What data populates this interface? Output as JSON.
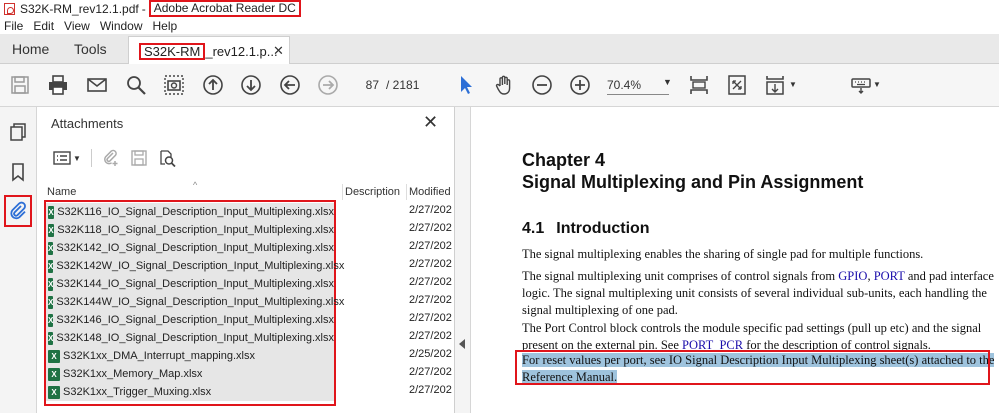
{
  "window": {
    "doc_filename": "S32K-RM_rev12.1.pdf",
    "separator": "-",
    "app_name": "Adobe Acrobat Reader DC"
  },
  "menu": [
    "File",
    "Edit",
    "View",
    "Window",
    "Help"
  ],
  "tabs": {
    "home": "Home",
    "tools": "Tools",
    "doc_tab_highlight": "S32K-RM",
    "doc_tab_rest": "_rev12.1.p...",
    "close_glyph": "✕"
  },
  "toolbar": {
    "page_current": "87",
    "page_total": "/  2181",
    "zoom": "70.4%",
    "icons": [
      "save-icon",
      "print-icon",
      "email-icon",
      "search-icon",
      "screenshot-icon",
      "page-up-icon",
      "page-down-icon",
      "back-icon",
      "forward-icon",
      "select-cursor-icon",
      "hand-icon",
      "zoom-out-icon",
      "zoom-in-icon",
      "fit-page-icon",
      "full-screen-icon",
      "scroll-mode-icon",
      "keyboard-icon"
    ]
  },
  "attachments": {
    "title": "Attachments",
    "close_glyph": "✕",
    "columns": {
      "name": "Name",
      "description": "Description",
      "modified": "Modified"
    },
    "files": [
      {
        "name": "S32K116_IO_Signal_Description_Input_Multiplexing.xlsx",
        "modified": "2/27/202"
      },
      {
        "name": "S32K118_IO_Signal_Description_Input_Multiplexing.xlsx",
        "modified": "2/27/202"
      },
      {
        "name": "S32K142_IO_Signal_Description_Input_Multiplexing.xlsx",
        "modified": "2/27/202"
      },
      {
        "name": "S32K142W_IO_Signal_Description_Input_Multiplexing.xlsx",
        "modified": "2/27/202"
      },
      {
        "name": "S32K144_IO_Signal_Description_Input_Multiplexing.xlsx",
        "modified": "2/27/202"
      },
      {
        "name": "S32K144W_IO_Signal_Description_Input_Multiplexing.xlsx",
        "modified": "2/27/202"
      },
      {
        "name": "S32K146_IO_Signal_Description_Input_Multiplexing.xlsx",
        "modified": "2/27/202"
      },
      {
        "name": "S32K148_IO_Signal_Description_Input_Multiplexing.xlsx",
        "modified": "2/27/202"
      },
      {
        "name": "S32K1xx_DMA_Interrupt_mapping.xlsx",
        "modified": "2/25/202"
      },
      {
        "name": "S32K1xx_Memory_Map.xlsx",
        "modified": "2/27/202"
      },
      {
        "name": "S32K1xx_Trigger_Muxing.xlsx",
        "modified": "2/27/202"
      }
    ]
  },
  "document": {
    "chapter": "Chapter 4",
    "chapter_title": "Signal Multiplexing and Pin Assignment",
    "section_num": "4.1",
    "section_title": "Introduction",
    "p1": "The signal multiplexing enables the sharing of single pad for multiple functions.",
    "p2_a": "The signal multiplexing unit comprises of control signals from ",
    "p2_link1": "GPIO",
    "p2_b": ", ",
    "p2_link2": "PORT",
    "p2_c": " and pad interface logic. The signal multiplexing unit consists of several individual sub-units, each handling the signal multiplexing of one pad.",
    "p3_a": "The Port Control block controls the module specific pad settings (pull up etc) and the signal present on the external pin. See ",
    "p3_link": "PORT_PCR",
    "p3_b": " for the description of control signals.",
    "p4_highlight": "For reset values per port, see IO Signal Description Input Multiplexing sheet(s) attached to the Reference Manual."
  },
  "colors": {
    "annotation_red": "#e0151b",
    "selection": "#9ec3dd",
    "link": "#1a0dab",
    "excel_green": "#1f7244"
  }
}
